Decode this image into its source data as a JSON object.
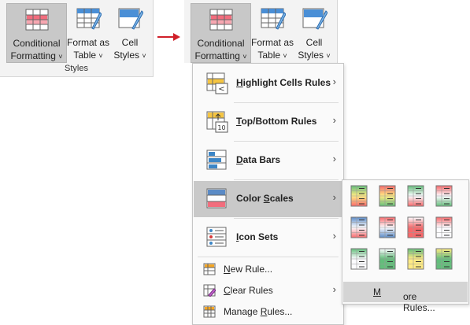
{
  "left_ribbon": {
    "buttons": [
      {
        "line1": "Conditional",
        "line2": "Formatting"
      },
      {
        "line1": "Format as",
        "line2": "Table"
      },
      {
        "line1": "Cell",
        "line2": "Styles"
      }
    ],
    "group_label": "Styles"
  },
  "right_ribbon": {
    "buttons": [
      {
        "line1": "Conditional",
        "line2": "Formatting"
      },
      {
        "line1": "Format as",
        "line2": "Table"
      },
      {
        "line1": "Cell",
        "line2": "Styles"
      }
    ]
  },
  "arrow_color": "#d0202a",
  "menu": {
    "items": [
      {
        "pre": "",
        "key": "H",
        "post": "ighlight Cells Rules",
        "icon": "highlight-cells-rules-icon"
      },
      {
        "pre": "",
        "key": "T",
        "post": "op/Bottom Rules",
        "icon": "top-bottom-rules-icon",
        "icon_text": "10"
      },
      {
        "pre": "",
        "key": "D",
        "post": "ata Bars",
        "icon": "data-bars-icon"
      },
      {
        "pre": "Color ",
        "key": "S",
        "post": "cales",
        "icon": "color-scales-icon"
      },
      {
        "pre": "",
        "key": "I",
        "post": "con Sets",
        "icon": "icon-sets-icon"
      },
      {
        "pre": "",
        "key": "N",
        "post": "ew Rule...",
        "icon": "new-rule-icon"
      },
      {
        "pre": "",
        "key": "C",
        "post": "lear Rules",
        "icon": "clear-rules-icon"
      },
      {
        "pre": "Manage ",
        "key": "R",
        "post": "ules...",
        "icon": "manage-rules-icon"
      }
    ]
  },
  "submenu": {
    "more_pre": "",
    "more_key": "M",
    "more_post": "ore Rules..."
  },
  "colors": {
    "green": "#63be7b",
    "yellow": "#ffeb84",
    "red": "#f8696b",
    "blue": "#5a8ac6",
    "white": "#fcfcff",
    "ribbon_bg": "#f3f3f3",
    "selected_bg": "#c8c8c8"
  }
}
